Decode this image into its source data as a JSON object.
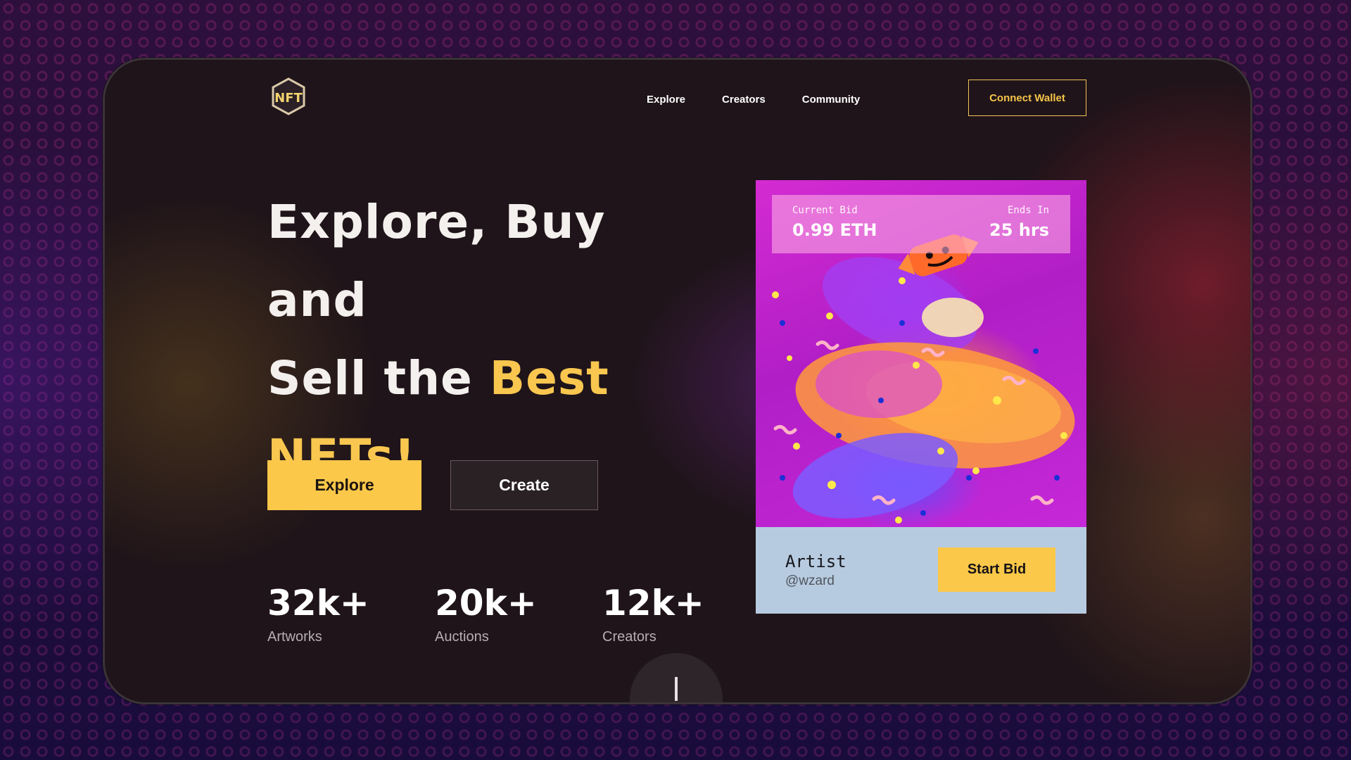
{
  "logo": {
    "text": "NFT"
  },
  "nav": {
    "items": [
      {
        "label": "Explore"
      },
      {
        "label": "Creators"
      },
      {
        "label": "Community"
      }
    ]
  },
  "header": {
    "connect_wallet_label": "Connect Wallet"
  },
  "hero": {
    "line1": "Explore, Buy and",
    "line2_prefix": "Sell the ",
    "line2_highlight": "Best",
    "line3_highlight": "NFTs!",
    "highlight_color": "#f9c74f"
  },
  "actions": {
    "explore_label": "Explore",
    "create_label": "Create"
  },
  "stats": [
    {
      "value": "32k+",
      "label": "Artworks"
    },
    {
      "value": "20k+",
      "label": "Auctions"
    },
    {
      "value": "12k+",
      "label": "Creators"
    }
  ],
  "card": {
    "current_bid_label": "Current Bid",
    "current_bid_value": "0.99 ETH",
    "ends_in_label": "Ends In",
    "ends_in_value": "25 hrs",
    "artist_title": "Artist",
    "artist_handle": "@wzard",
    "start_bid_label": "Start Bid"
  },
  "colors": {
    "accent": "#fcc84a",
    "panel": "#1f1419",
    "card_footer": "#b7cbe0"
  }
}
